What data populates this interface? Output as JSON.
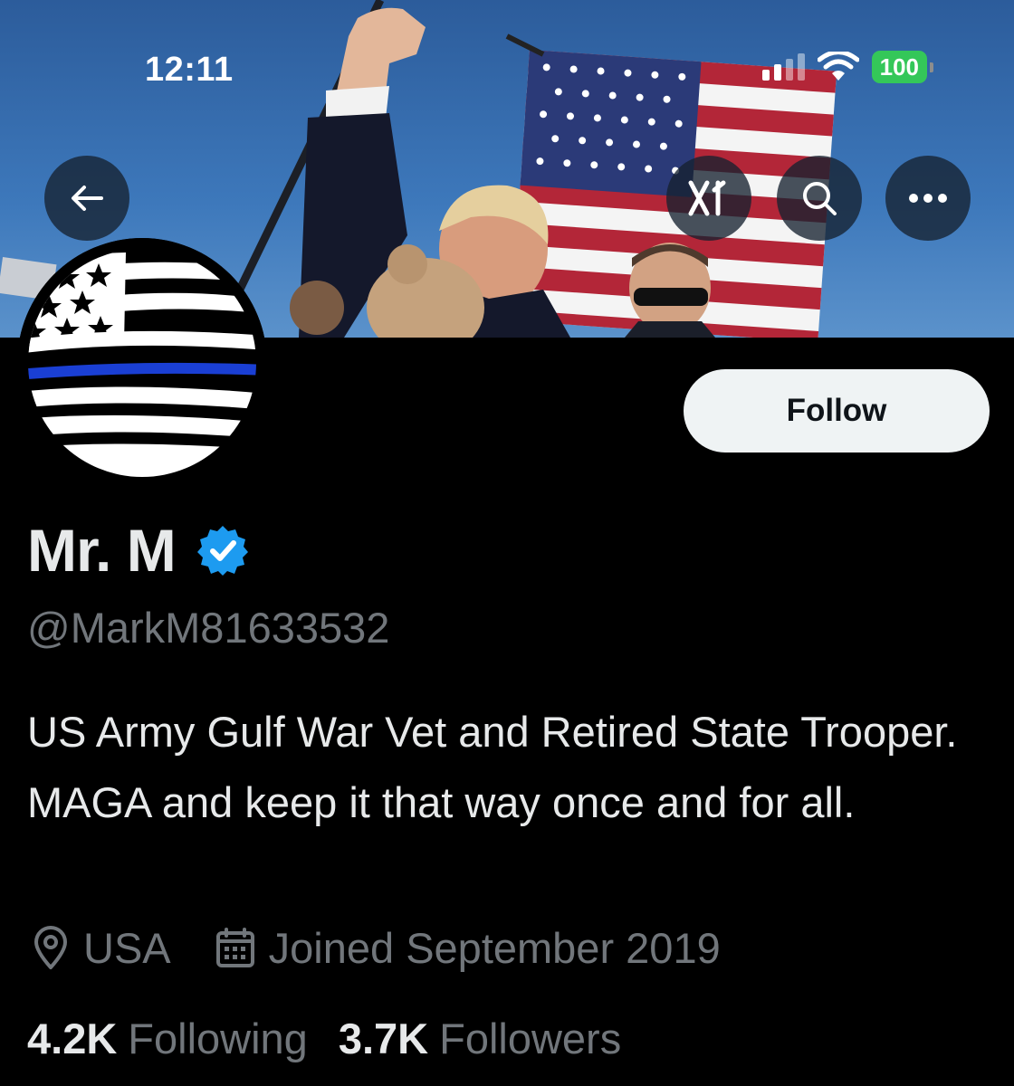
{
  "status_bar": {
    "time": "12:11",
    "battery": "100"
  },
  "nav": {
    "back_icon": "arrow-left-icon",
    "grok_icon": "grok-icon",
    "search_icon": "search-icon",
    "more_icon": "more-icon"
  },
  "profile": {
    "follow_label": "Follow",
    "display_name": "Mr. M",
    "verified": true,
    "handle": "@MarkM81633532",
    "bio": "US Army Gulf War Vet and Retired State Trooper. MAGA and keep it that way once and for all.",
    "location": "USA",
    "joined": "Joined September 2019",
    "following_count": "4.2K",
    "following_label": "Following",
    "followers_count": "3.7K",
    "followers_label": "Followers"
  },
  "colors": {
    "background": "#000000",
    "text_primary": "#e7e9ea",
    "text_secondary": "#71767b",
    "verified_blue": "#1d9bf0",
    "battery_green": "#34c759",
    "follow_button_bg": "#eff3f4",
    "thin_blue_line": "#1a3fd4"
  }
}
